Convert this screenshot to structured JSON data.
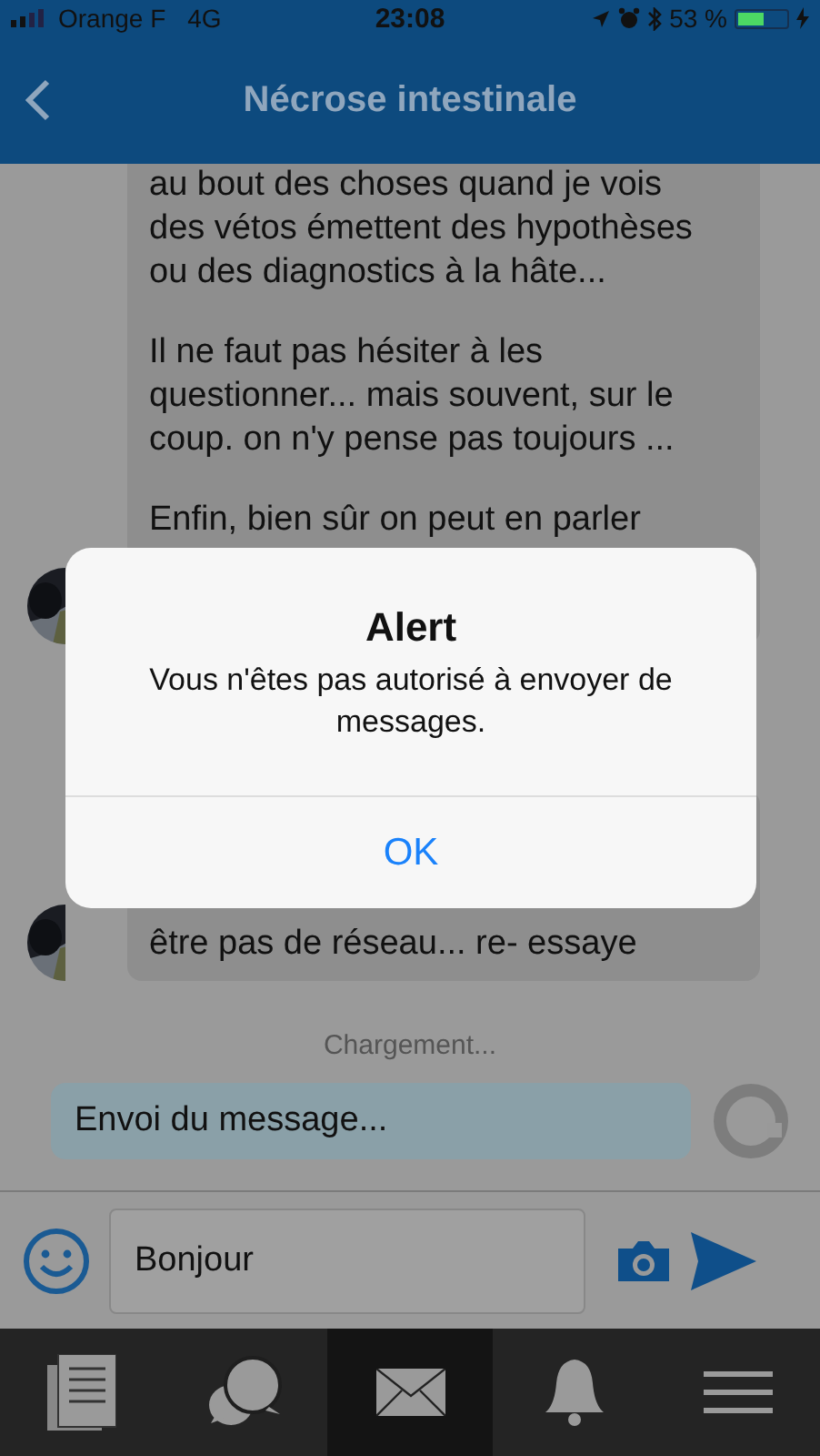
{
  "status_bar": {
    "carrier": "Orange F",
    "network": "4G",
    "time": "23:08",
    "battery": "53 %"
  },
  "header": {
    "title": "Nécrose intestinale"
  },
  "messages": [
    {
      "paragraphs": [
        "au bout des choses quand je vois des vétos émettent des hypothèses ou des diagnostics à la hâte...",
        "Il ne faut pas hésiter à les questionner... mais souvent, sur le coup. on n'y pense pas toujours ...",
        "Enfin, bien sûr on peut en parler"
      ]
    },
    {
      "paragraphs": [
        "être pas de réseau... re- essaye"
      ]
    }
  ],
  "loading": "Chargement...",
  "outgoing": {
    "text": "Envoi du message..."
  },
  "composer": {
    "value": "Bonjour"
  },
  "tabs": [
    {
      "kind": "news",
      "selected": false
    },
    {
      "kind": "chat",
      "selected": false
    },
    {
      "kind": "mail",
      "selected": true
    },
    {
      "kind": "bell",
      "selected": false
    },
    {
      "kind": "menu",
      "selected": false
    }
  ],
  "alert": {
    "title": "Alert",
    "message": "Vous n'êtes pas autorisé à envoyer de messages.",
    "button": "OK"
  }
}
